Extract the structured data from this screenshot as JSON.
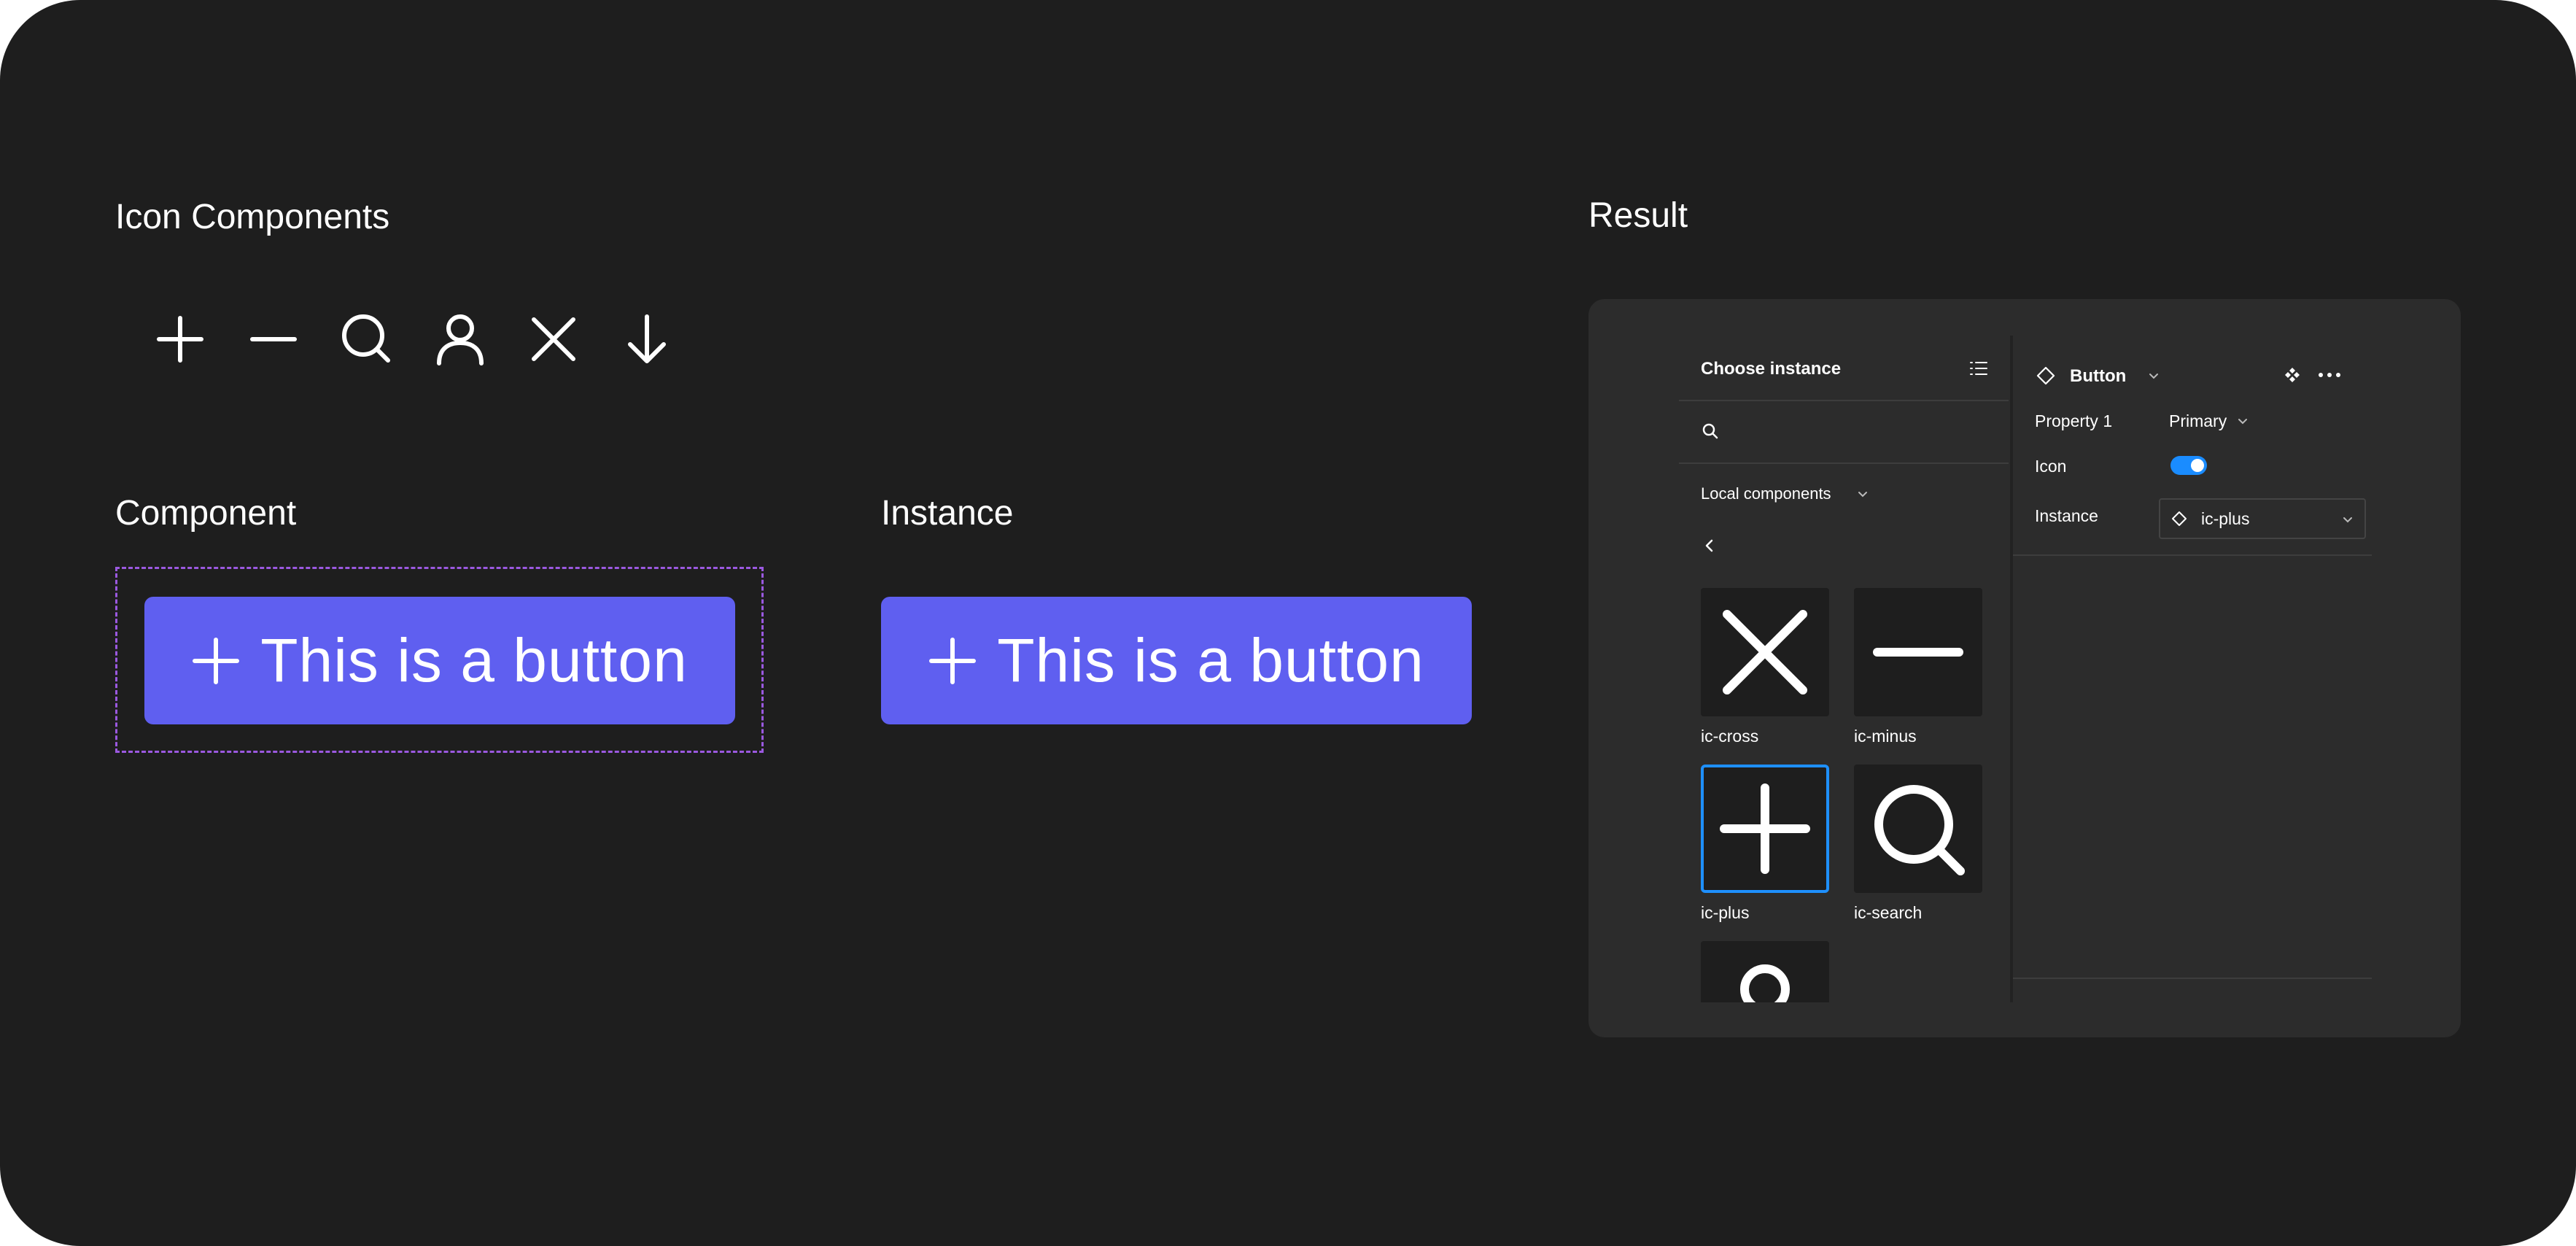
{
  "headings": {
    "icon_components": "Icon Components",
    "component": "Component",
    "instance": "Instance",
    "result": "Result"
  },
  "icons": [
    "plus-icon",
    "minus-icon",
    "search-icon",
    "user-icon",
    "cross-icon",
    "arrow-down-icon"
  ],
  "button": {
    "label": "This is a button",
    "color": "#5f5ff0"
  },
  "component_frame_color": "#9b59e0",
  "picker": {
    "title": "Choose instance",
    "library": "Local components",
    "tiles": [
      {
        "name": "ic-cross",
        "icon": "cross-icon",
        "selected": false
      },
      {
        "name": "ic-minus",
        "icon": "minus-icon",
        "selected": false
      },
      {
        "name": "ic-plus",
        "icon": "plus-icon",
        "selected": true
      },
      {
        "name": "ic-search",
        "icon": "search-icon",
        "selected": false
      }
    ],
    "selection_color": "#1e90ff"
  },
  "properties": {
    "component_name": "Button",
    "rows": {
      "property1_label": "Property 1",
      "property1_value": "Primary",
      "icon_label": "Icon",
      "icon_enabled": true,
      "instance_label": "Instance",
      "instance_value": "ic-plus"
    },
    "toggle_color": "#1a8cff"
  },
  "colors": {
    "background": "#1e1e1e",
    "panel": "#2c2c2c"
  }
}
